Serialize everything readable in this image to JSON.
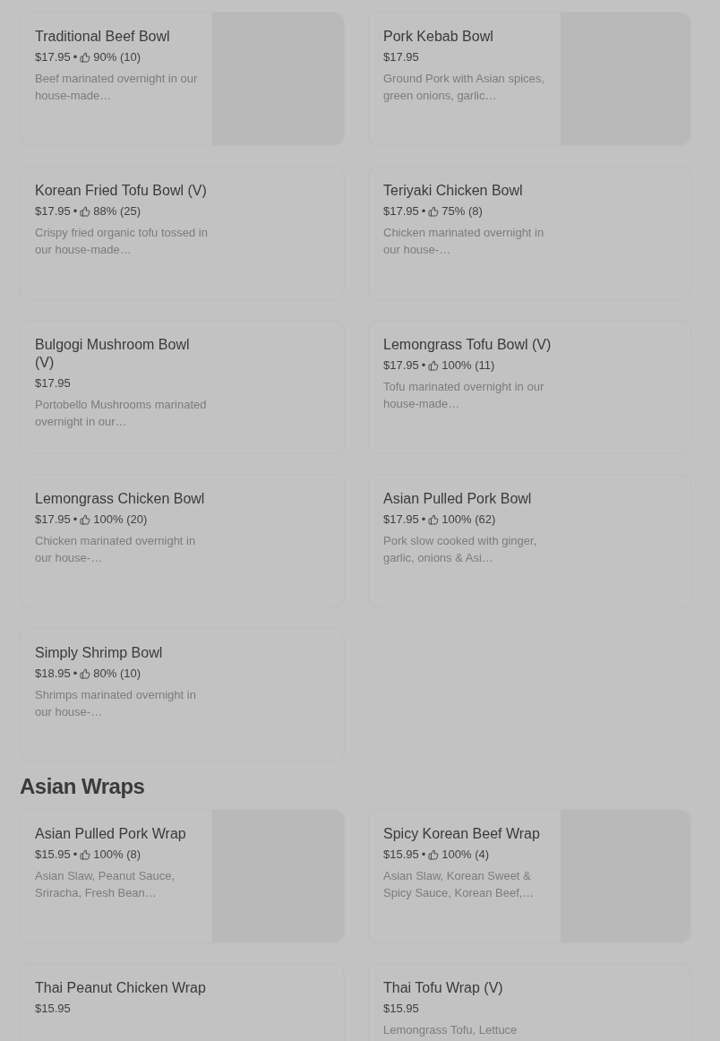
{
  "sections": [
    {
      "items": [
        {
          "kind": "with_image",
          "name": "Traditional Beef Bowl",
          "price": "$17.95",
          "separator": "•",
          "rating": "90% (10)",
          "description": "Beef marinated overnight in our house-made…"
        },
        {
          "kind": "with_image",
          "name": "Pork Kebab Bowl",
          "price": "$17.95",
          "description": "Ground Pork with Asian spices, green onions, garlic…"
        },
        {
          "kind": "text_only",
          "name": "Korean Fried Tofu Bowl (V)",
          "price": "$17.95",
          "separator": "•",
          "rating": "88% (25)",
          "description": "Crispy fried organic tofu tossed in our house-made…"
        },
        {
          "kind": "text_only",
          "name": "Teriyaki Chicken Bowl",
          "price": "$17.95",
          "separator": "•",
          "rating": "75% (8)",
          "description": "Chicken marinated overnight in our house-…"
        },
        {
          "kind": "text_only",
          "name": "Bulgogi Mushroom Bowl (V)",
          "price": "$17.95",
          "description": "Portobello Mushrooms marinated overnight in our…"
        },
        {
          "kind": "text_only",
          "name": "Lemongrass Tofu Bowl (V)",
          "price": "$17.95",
          "separator": "•",
          "rating": "100% (11)",
          "description": "Tofu marinated overnight in our house-made…"
        },
        {
          "kind": "text_only",
          "name": "Lemongrass Chicken Bowl",
          "price": "$17.95",
          "separator": "•",
          "rating": "100% (20)",
          "description": "Chicken marinated overnight in our house-…"
        },
        {
          "kind": "text_only",
          "name": "Asian Pulled Pork Bowl",
          "price": "$17.95",
          "separator": "•",
          "rating": "100% (62)",
          "description": "Pork slow cooked with ginger, garlic, onions & Asi…"
        },
        {
          "kind": "text_only",
          "name": "Simply Shrimp Bowl",
          "price": "$18.95",
          "separator": "•",
          "rating": "80% (10)",
          "description": "Shrimps marinated overnight in our house-…"
        }
      ]
    },
    {
      "title": "Asian Wraps",
      "items": [
        {
          "kind": "with_image",
          "name": "Asian Pulled Pork Wrap",
          "price": "$15.95",
          "separator": "•",
          "rating": "100% (8)",
          "description": "Asian Slaw, Peanut Sauce, Sriracha, Fresh Bean…"
        },
        {
          "kind": "with_image",
          "name": "Spicy Korean Beef Wrap",
          "price": "$15.95",
          "separator": "•",
          "rating": "100% (4)",
          "description": "Asian Slaw, Korean Sweet & Spicy Sauce, Korean Beef,…"
        },
        {
          "kind": "text_only",
          "name": "Thai Peanut Chicken Wrap",
          "price": "$15.95"
        },
        {
          "kind": "text_only",
          "name": "Thai Tofu Wrap (V)",
          "price": "$15.95",
          "description": "Lemongrass Tofu, Lettuce"
        }
      ]
    }
  ]
}
